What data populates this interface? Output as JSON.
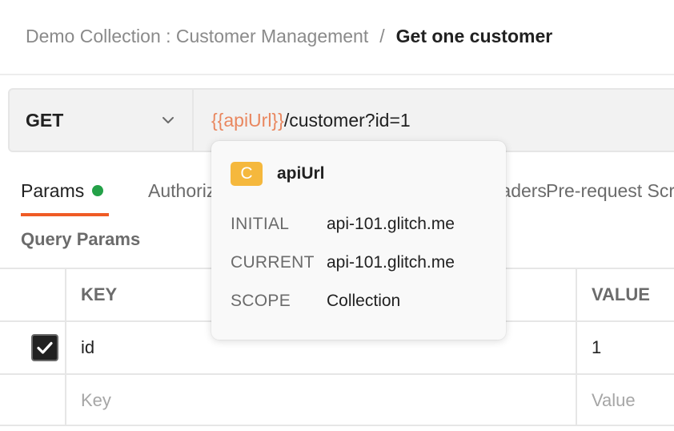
{
  "breadcrumb": {
    "parent": "Demo Collection : Customer Management",
    "separator": "/",
    "current": "Get one customer"
  },
  "request": {
    "method": "GET",
    "url_variable": "{{apiUrl}}",
    "url_path": "/customer?id=1"
  },
  "tabs": {
    "params": "Params",
    "authorization": "Authorization",
    "headers": "Headers",
    "prerequest": "Pre-request Script"
  },
  "query_params": {
    "title": "Query Params",
    "headers": {
      "key": "KEY",
      "value": "VALUE"
    },
    "rows": [
      {
        "checked": true,
        "key": "id",
        "value": "1"
      }
    ],
    "new_row": {
      "key_placeholder": "Key",
      "value_placeholder": "Value"
    }
  },
  "variable_popover": {
    "badge": "C",
    "name": "apiUrl",
    "initial_label": "INITIAL",
    "initial_value": "api-101.glitch.me",
    "current_label": "CURRENT",
    "current_value": "api-101.glitch.me",
    "scope_label": "SCOPE",
    "scope_value": "Collection"
  },
  "colors": {
    "accent": "#ef5b25",
    "variable": "#e9875f",
    "status_dot": "#24a148",
    "badge": "#f5b83d"
  },
  "icons": {
    "method_dropdown": "chevron-down-icon",
    "checkbox": "checkmark-icon"
  }
}
